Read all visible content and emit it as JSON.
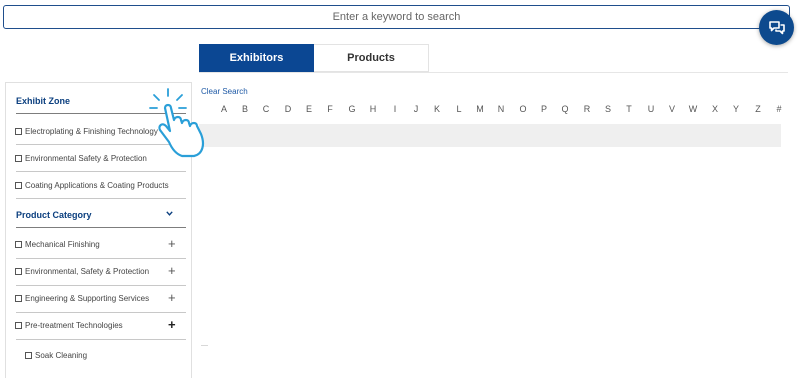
{
  "search": {
    "placeholder": "Enter a keyword to search"
  },
  "tabs": [
    {
      "label": "Exhibitors",
      "active": true
    },
    {
      "label": "Products",
      "active": false
    }
  ],
  "sidebar": {
    "exhibit_zone": {
      "heading": "Exhibit Zone",
      "items": [
        "Electroplating & Finishing Technology",
        "Environmental Safety & Protection",
        "Coating Applications & Coating Products"
      ]
    },
    "product_category": {
      "heading": "Product Category",
      "items": [
        "Mechanical Finishing",
        "Environmental, Safety & Protection",
        "Engineering & Supporting Services",
        "Pre-treatment Technologies"
      ],
      "subitems": [
        "Soak Cleaning"
      ]
    }
  },
  "clear_search": "Clear Search",
  "alphabet": [
    "A",
    "B",
    "C",
    "D",
    "E",
    "F",
    "G",
    "H",
    "I",
    "J",
    "K",
    "L",
    "M",
    "N",
    "O",
    "P",
    "Q",
    "R",
    "S",
    "T",
    "U",
    "V",
    "W",
    "X",
    "Y",
    "Z",
    "#"
  ],
  "icons": {
    "chat": "chat-bubbles-icon",
    "pointer": "pointing-hand-icon",
    "expand": "plus-icon",
    "collapse": "chevron-down-icon"
  },
  "colors": {
    "primary": "#0b4793",
    "link": "#1f5aa6",
    "heading": "#0b3f7f"
  }
}
